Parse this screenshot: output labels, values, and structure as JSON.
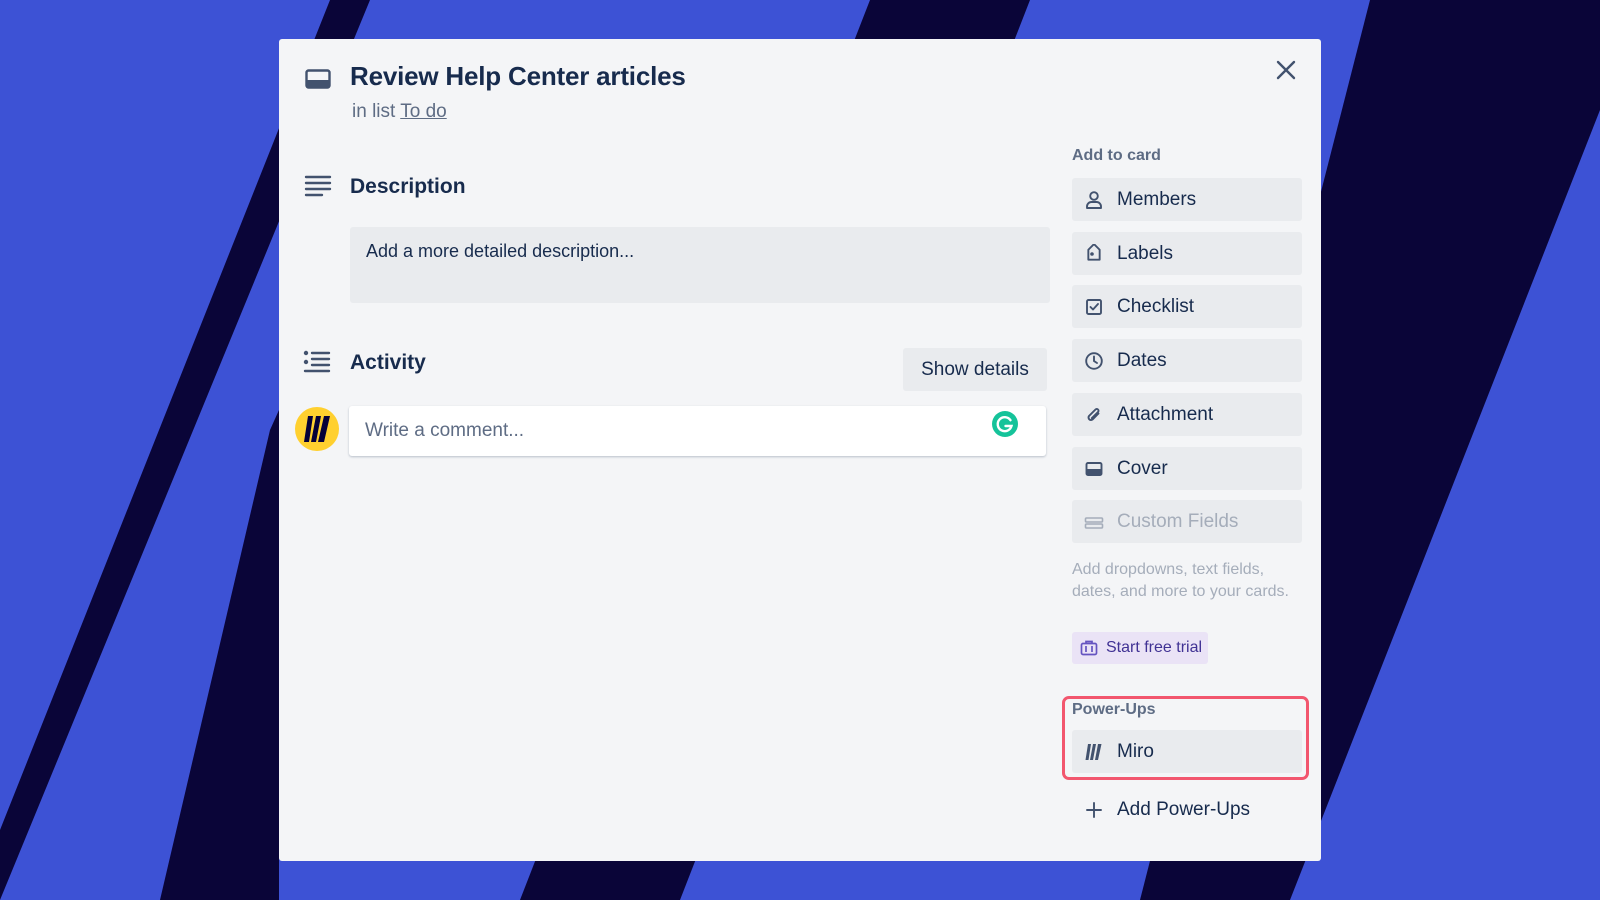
{
  "colors": {
    "background": "#3d52d5",
    "stripe": "#0a0538",
    "modal": "#f4f5f7",
    "highlight": "#f2566e",
    "miro_yellow": "#ffd02f",
    "grammarly_green": "#15c39a"
  },
  "card": {
    "title": "Review Help Center articles",
    "in_list_prefix": "in list",
    "list_name": "To do",
    "title_icon": "card-icon",
    "close_icon": "close-icon"
  },
  "description": {
    "heading": "Description",
    "placeholder": "Add a more detailed description...",
    "icon": "description-lines-icon"
  },
  "activity": {
    "heading": "Activity",
    "show_details_label": "Show details",
    "comment_placeholder": "Write a comment...",
    "avatar_icon": "miro-logo-icon",
    "grammarly_icon": "grammarly-icon"
  },
  "sidebar": {
    "add_to_card_heading": "Add to card",
    "items": [
      {
        "label": "Members",
        "icon": "person-icon"
      },
      {
        "label": "Labels",
        "icon": "tag-icon"
      },
      {
        "label": "Checklist",
        "icon": "checklist-icon"
      },
      {
        "label": "Dates",
        "icon": "clock-icon"
      },
      {
        "label": "Attachment",
        "icon": "paperclip-icon"
      },
      {
        "label": "Cover",
        "icon": "cover-icon"
      },
      {
        "label": "Custom Fields",
        "icon": "custom-fields-icon",
        "disabled": true
      }
    ],
    "custom_fields_hint": "Add dropdowns, text fields, dates, and more to your cards.",
    "start_trial_label": "Start free trial",
    "power_ups_heading": "Power-Ups",
    "miro_label": "Miro",
    "add_power_ups_label": "Add Power-Ups"
  }
}
